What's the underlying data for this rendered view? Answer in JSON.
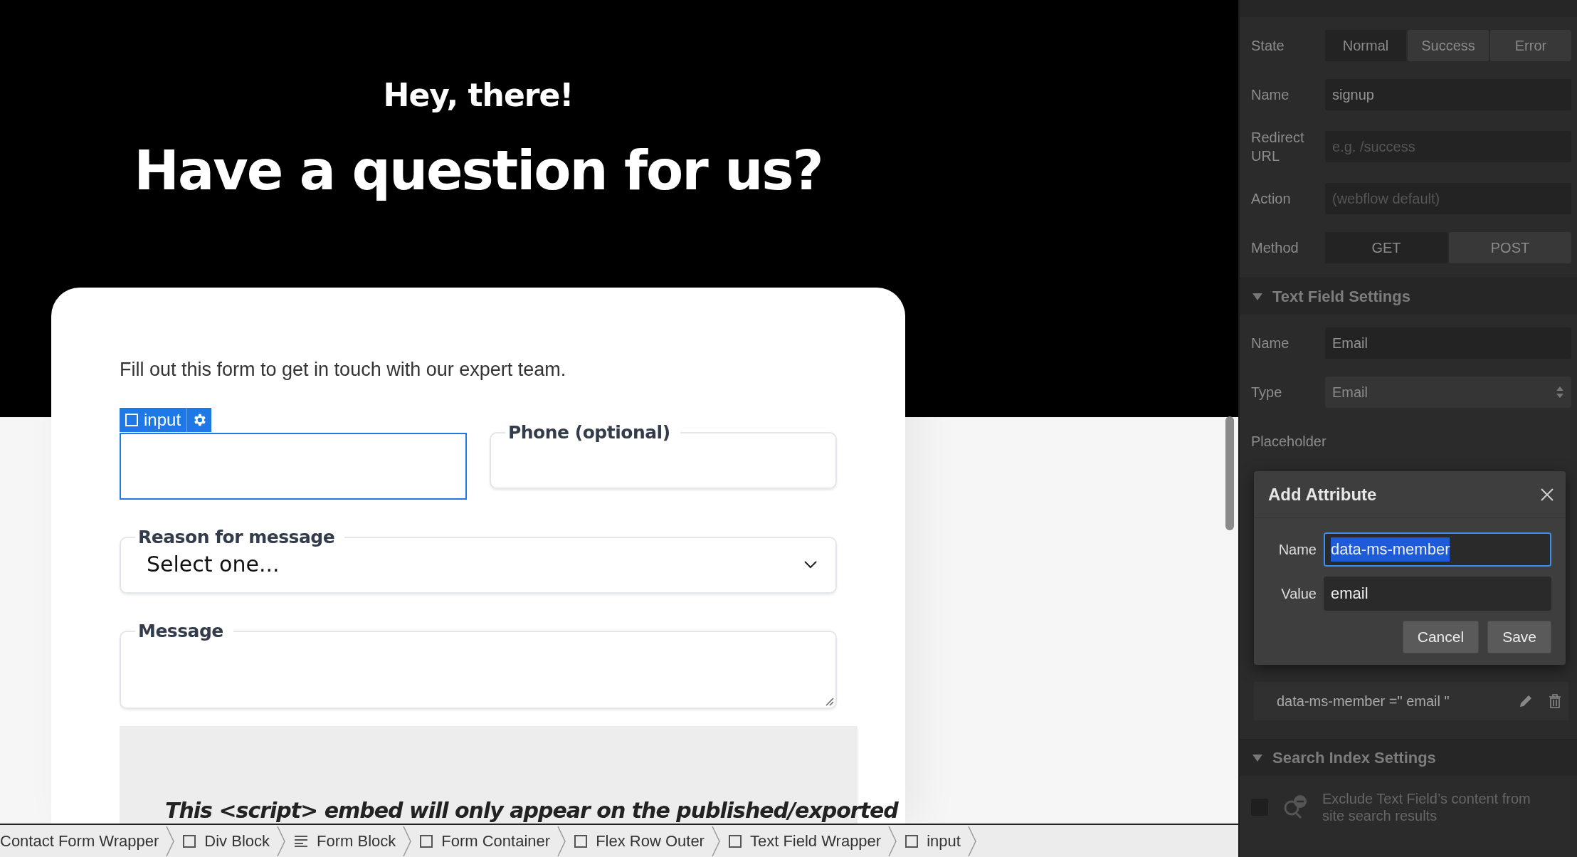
{
  "canvas": {
    "greeting": "Hey, there!",
    "headline": "Have a question for us?",
    "form": {
      "intro": "Fill out this form to get in touch with our expert team.",
      "selection_badge": {
        "label": "input"
      },
      "fields": [
        {
          "kind": "text",
          "selected": true
        },
        {
          "kind": "text",
          "label": "Phone (optional)",
          "selected": false
        },
        {
          "kind": "select",
          "label": "Reason for message",
          "value": "Select one...",
          "selected": false
        },
        {
          "kind": "textarea",
          "label": "Message",
          "selected": false
        }
      ],
      "embed_notice": "This <script> embed will only appear on the published/exported"
    }
  },
  "breadcrumbs": [
    {
      "label": "Contact Form Wrapper",
      "kind": "plain"
    },
    {
      "label": "Div Block",
      "kind": "box"
    },
    {
      "label": "Form Block",
      "kind": "form"
    },
    {
      "label": "Form Container",
      "kind": "box"
    },
    {
      "label": "Flex Row Outer",
      "kind": "box"
    },
    {
      "label": "Text Field Wrapper",
      "kind": "box"
    },
    {
      "label": "input",
      "kind": "box"
    }
  ],
  "settings_panel": {
    "form_settings": {
      "rows": [
        {
          "kind": "segmented",
          "label": "State",
          "options": [
            {
              "label": "Normal",
              "selected": true
            },
            {
              "label": "Success",
              "selected": false
            },
            {
              "label": "Error",
              "selected": false
            }
          ]
        },
        {
          "kind": "input",
          "label": "Name",
          "value": "signup"
        },
        {
          "kind": "input",
          "label": "Redirect URL",
          "placeholder": "e.g. /success"
        },
        {
          "kind": "input",
          "label": "Action",
          "placeholder": "(webflow default)"
        },
        {
          "kind": "segmented",
          "label": "Method",
          "options": [
            {
              "label": "GET",
              "selected": true
            },
            {
              "label": "POST",
              "selected": false
            }
          ]
        }
      ]
    },
    "text_field_settings": {
      "title": "Text Field Settings",
      "expanded": true,
      "rows": [
        {
          "kind": "input",
          "label": "Name",
          "value": "Email"
        },
        {
          "kind": "select",
          "label": "Type",
          "value": "Email"
        },
        {
          "kind": "label",
          "label": "Placeholder"
        }
      ]
    },
    "attributes": [
      {
        "text": "data-ms-member =\" email \""
      }
    ],
    "search_index_settings": {
      "title": "Search Index Settings",
      "expanded": true,
      "exclude": {
        "label": "Exclude Text Field’s content from site search results",
        "checked": false
      }
    }
  },
  "dialog": {
    "title": "Add Attribute",
    "fields": [
      {
        "label": "Name",
        "value": "data-ms-member",
        "selected": true
      },
      {
        "label": "Value",
        "value": "email",
        "selected": false
      }
    ],
    "buttons": [
      "Cancel",
      "Save"
    ]
  }
}
